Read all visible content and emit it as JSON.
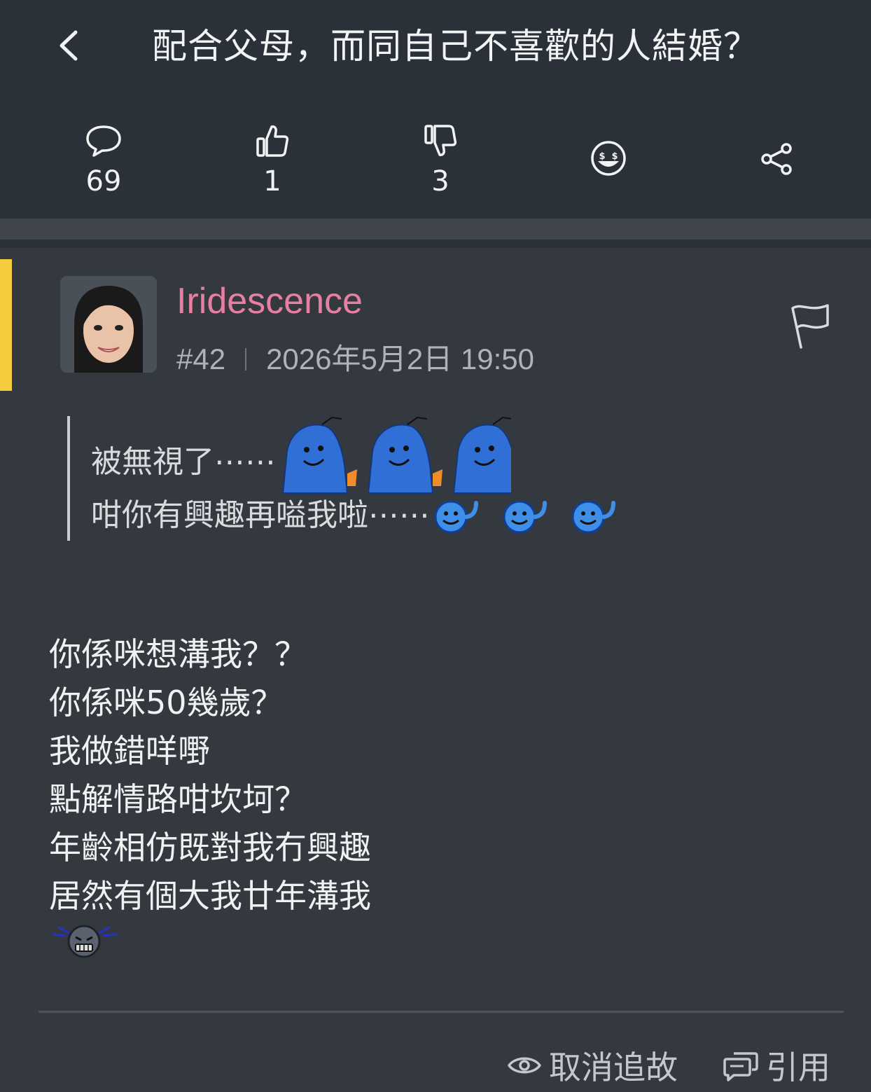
{
  "header": {
    "title": "配合父母，而同自己不喜歡的人結婚？",
    "back_icon": "chevron-left-icon"
  },
  "actions": [
    {
      "name": "comments",
      "icon": "comment-bubble-icon",
      "count": "69"
    },
    {
      "name": "likes",
      "icon": "thumbs-up-icon",
      "count": "1"
    },
    {
      "name": "dislikes",
      "icon": "thumbs-down-icon",
      "count": "3"
    },
    {
      "name": "reaction",
      "icon": "money-face-icon"
    },
    {
      "name": "share",
      "icon": "share-icon"
    }
  ],
  "post": {
    "username": "Iridescence",
    "floor": "#42",
    "datetime": "2026年5月2日 19:50",
    "quote_lines": [
      "被無視了⋯⋯",
      "咁你有興趣再嗌我啦⋯⋯"
    ],
    "body_lines": [
      "你係咪想溝我？？",
      "你係咪50幾歲？",
      "我做錯咩嘢",
      "點解情路咁坎坷？",
      "年齡相仿既對我冇興趣",
      "居然有個大我廿年溝我"
    ]
  },
  "footer": {
    "unfollow_label": "取消追故",
    "quote_label": "引用"
  },
  "colors": {
    "background": "#343940",
    "header": "#2b3138",
    "accent": "#f4cb3c",
    "username": "#e77fa3"
  }
}
